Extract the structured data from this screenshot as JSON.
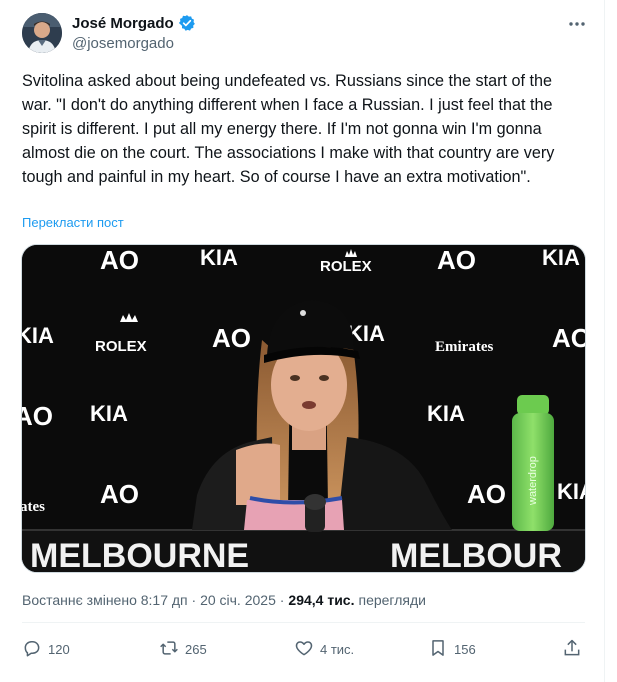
{
  "author": {
    "name": "José Morgado",
    "handle": "@josemorgado",
    "verified": true
  },
  "tweet": {
    "text": "Svitolina asked about being undefeated vs. Russians since the start of the war. \"I don't do anything different when I face a Russian. I just feel that the spirit is different. I put all my energy there. If I'm not gonna win I'm gonna almost die on the court. The associations I make with that country are very tough and painful in my heart. So of course I have an extra motivation\".",
    "translate_label": "Перекласти пост"
  },
  "media": {
    "backdrop_words": {
      "ao": "AO",
      "kia": "KIA",
      "rolex": "ROLEX",
      "emirates": "Emirates",
      "melbourne": "MELBOURNE",
      "melbourne_partial": "MELBOUR",
      "ates": "ates",
      "bottle_text": "waterdrop"
    }
  },
  "meta": {
    "edited": "Востаннє змінено 8:17 дп · 20 січ. 2025 ·",
    "views_count": "294,4 тис.",
    "views_label": "перегляди"
  },
  "actions": {
    "replies": "120",
    "reposts": "265",
    "likes": "4 тис.",
    "bookmarks": "156"
  },
  "colors": {
    "accent": "#1d9bf0",
    "secondary_text": "#536471",
    "bottle": "#7ed957"
  },
  "icons": [
    "verified-badge-icon",
    "more-icon",
    "reply-icon",
    "repost-icon",
    "like-icon",
    "bookmark-icon",
    "share-icon"
  ]
}
